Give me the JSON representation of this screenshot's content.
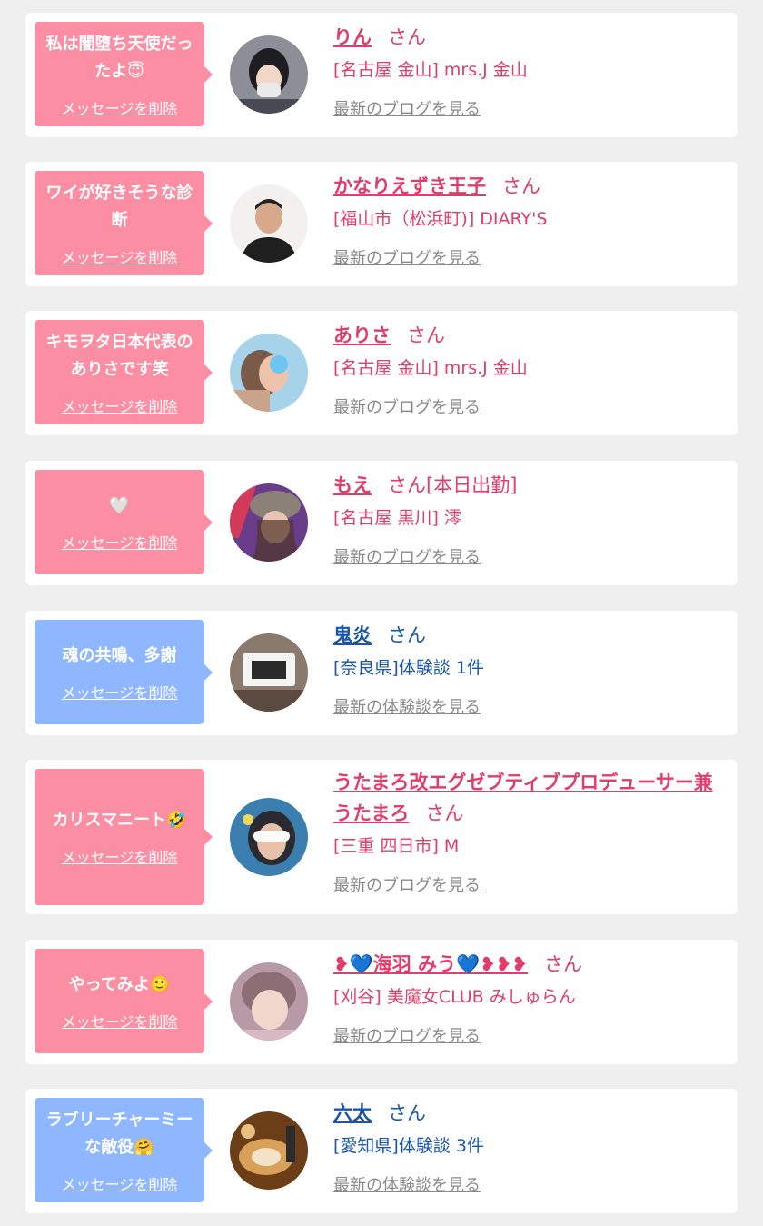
{
  "entries": [
    {
      "message": "私は闇堕ち天使だったよ😇",
      "delete_label": "メッセージを削除",
      "name": "りん",
      "suffix": "さん",
      "shop": "[名古屋 金山] mrs.J 金山",
      "link": "最新のブログを見る",
      "type": "pink"
    },
    {
      "message": "ワイが好きそうな診断",
      "delete_label": "メッセージを削除",
      "name": "かなりえずき王子",
      "suffix": "さん",
      "shop": "[福山市（松浜町)] DIARY'S",
      "link": "最新のブログを見る",
      "type": "pink"
    },
    {
      "message": "キモヲタ日本代表のありさです笑",
      "delete_label": "メッセージを削除",
      "name": "ありさ",
      "suffix": "さん",
      "shop": "[名古屋 金山] mrs.J 金山",
      "link": "最新のブログを見る",
      "type": "pink"
    },
    {
      "message": "🤍",
      "delete_label": "メッセージを削除",
      "name": "もえ",
      "suffix": "さん[本日出勤]",
      "shop": "[名古屋 黒川] 澪",
      "link": "最新のブログを見る",
      "type": "pink"
    },
    {
      "message": "魂の共鳴、多謝",
      "delete_label": "メッセージを削除",
      "name": "鬼炎",
      "suffix": "さん",
      "shop": "[奈良県]体験談 1件",
      "link": "最新の体験談を見る",
      "type": "blue"
    },
    {
      "message": "カリスマニート🤣",
      "delete_label": "メッセージを削除",
      "name": "うたまろ改エグゼブティブプロデューサー兼うたまろ",
      "suffix": "さん",
      "shop": "[三重 四日市] M",
      "link": "最新のブログを見る",
      "type": "pink"
    },
    {
      "message": "やってみよ🙂",
      "delete_label": "メッセージを削除",
      "name": "❥💙海羽 みう💙❥❥❥",
      "suffix": "さん",
      "shop": "[刈谷] 美魔女CLUB みしゅらん",
      "link": "最新のブログを見る",
      "type": "pink"
    },
    {
      "message": "ラブリーチャーミーな敵役🤗",
      "delete_label": "メッセージを削除",
      "name": "六太",
      "suffix": "さん",
      "shop": "[愛知県]体験談 3件",
      "link": "最新の体験談を見る",
      "type": "blue"
    }
  ]
}
